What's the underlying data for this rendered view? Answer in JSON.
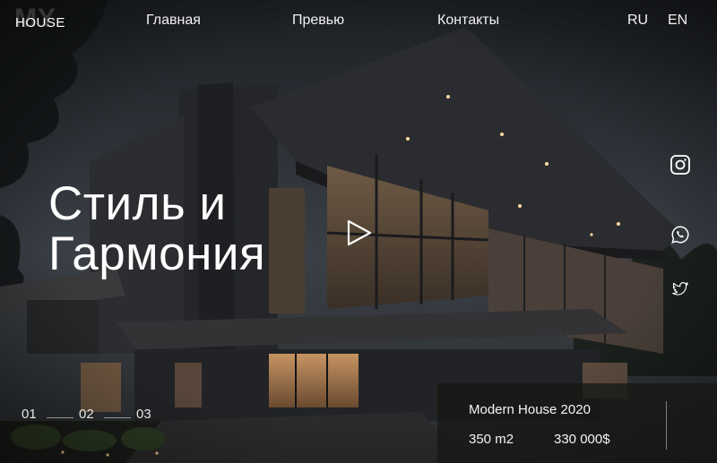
{
  "header": {
    "logo_mark": "MY",
    "logo_word": "HOUSE",
    "nav": [
      "Главная",
      "Превью",
      "Контакты"
    ],
    "languages": [
      "RU",
      "EN"
    ]
  },
  "hero": {
    "title_line1": "Стиль и",
    "title_line2": "Гармония"
  },
  "social": [
    "instagram-icon",
    "whatsapp-icon",
    "twitter-icon"
  ],
  "pager": [
    "01",
    "02",
    "03"
  ],
  "card": {
    "title": "Modern House 2020",
    "area": "350 m2",
    "price": "330 000$"
  },
  "colors": {
    "sky": "#2b3036",
    "glass_light": "#8a6a4a",
    "text": "#ffffff"
  }
}
